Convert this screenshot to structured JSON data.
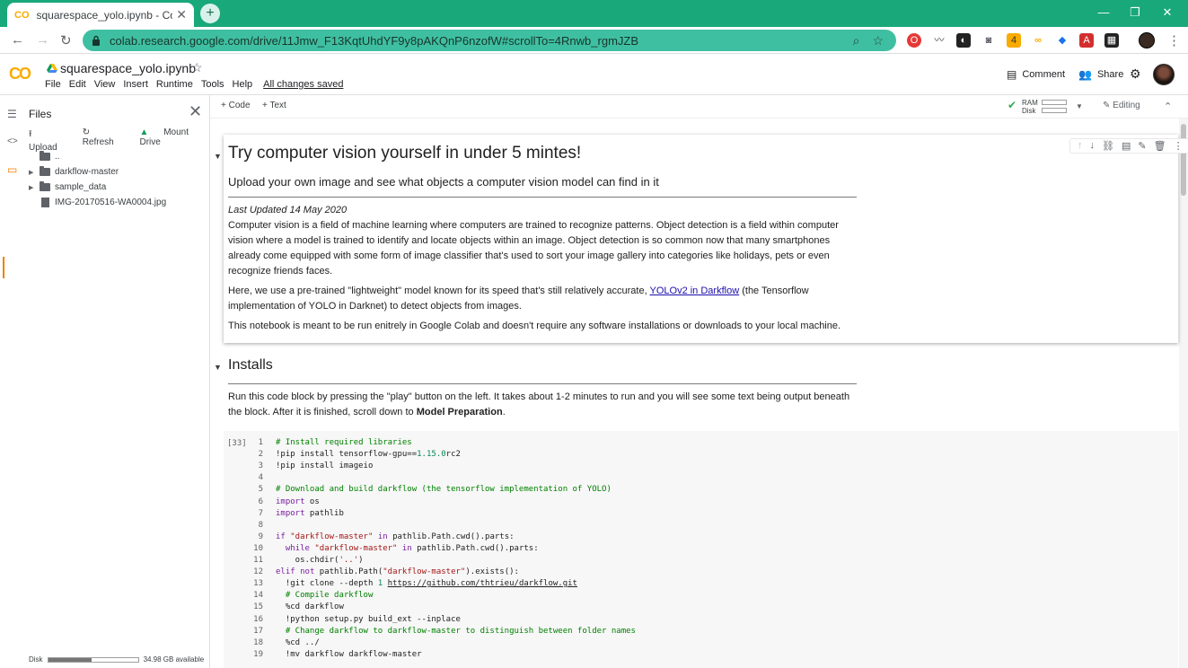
{
  "browser": {
    "tab_title": "squarespace_yolo.ipynb - Colabo",
    "tab_logo": "CO",
    "url": "colab.research.google.com/drive/11Jmw_F13KqtUhdYF9y8pAKQnP6nzofW#scrollTo=4Rnwb_rgmJZB",
    "extension_badge": "4"
  },
  "colab": {
    "logo": "CO",
    "doc_name": "squarespace_yolo.ipynb",
    "menus": [
      "File",
      "Edit",
      "View",
      "Insert",
      "Runtime",
      "Tools",
      "Help"
    ],
    "save_status": "All changes saved",
    "comment_label": "Comment",
    "share_label": "Share"
  },
  "files_panel": {
    "title": "Files",
    "upload_label": "Upload",
    "refresh_label": "Refresh",
    "mount_label": "Mount Drive",
    "items": [
      {
        "name": "..",
        "type": "folder"
      },
      {
        "name": "darkflow-master",
        "type": "folder"
      },
      {
        "name": "sample_data",
        "type": "folder"
      },
      {
        "name": "IMG-20170516-WA0004.jpg",
        "type": "file"
      }
    ],
    "disk_label": "Disk",
    "disk_available": "34.98 GB available",
    "disk_used_fraction": 0.48
  },
  "toolbar": {
    "code_label": "Code",
    "text_label": "Text",
    "ram_label": "RAM",
    "disk_label": "Disk",
    "editing_label": "Editing"
  },
  "notebook": {
    "intro": {
      "title": "Try computer vision yourself in under 5 mintes!",
      "subtitle": "Upload your own image and see what objects a computer vision model can find in it",
      "updated": "Last Updated 14 May 2020",
      "p1_a": "Computer vision is a field of machine learning where computers are trained to recognize patterns. Object detection is a field within computer",
      "p1_b": "vision where a model is trained to identify and locate objects within an image. Object detection is so common now that many smartphones",
      "p1_c": "already come equipped with some form of image classifier that's used to sort your image gallery into categories like holidays, pets or even",
      "p1_d": "recognize friends faces.",
      "p2_a": "Here, we use a pre-trained \"lightweight\" model known for its speed that's still relatively accurate,",
      "p2_link": "YOLOv2 in Darkflow",
      "p2_b": "(the Tensorflow",
      "p2_c": "implementation of YOLO in Darknet) to detect objects from images.",
      "p3": "This notebook is meant to be run enitrely in Google Colab and doesn't require any software installations or downloads to your local machine."
    },
    "installs": {
      "heading": "Installs",
      "p1": "Run this code block by pressing the \"play\" button on the left. It takes about 1-2 minutes to run and you will see some text being output beneath",
      "p2_a": "the block. After it is finished, scroll down to",
      "p2_bold": "Model Preparation",
      "p2_b": "."
    },
    "code_cell": {
      "exec_count": "[33]",
      "lines": [
        {
          "n": "1",
          "t": "# Install required libraries"
        },
        {
          "n": "2",
          "t": "!pip install tensorflow-gpu==1.15.0rc2"
        },
        {
          "n": "3",
          "t": "!pip install imageio"
        },
        {
          "n": "4",
          "t": ""
        },
        {
          "n": "5",
          "t": "# Download and build darkflow (the tensorflow implementation of YOLO)"
        },
        {
          "n": "6",
          "t": "import os"
        },
        {
          "n": "7",
          "t": "import pathlib"
        },
        {
          "n": "8",
          "t": ""
        },
        {
          "n": "9",
          "t": "if \"darkflow-master\" in pathlib.Path.cwd().parts:"
        },
        {
          "n": "10",
          "t": "  while \"darkflow-master\" in pathlib.Path.cwd().parts:"
        },
        {
          "n": "11",
          "t": "    os.chdir('..')"
        },
        {
          "n": "12",
          "t": "elif not pathlib.Path(\"darkflow-master\").exists():"
        },
        {
          "n": "13",
          "t": "  !git clone --depth 1 https://github.com/thtrieu/darkflow.git"
        },
        {
          "n": "14",
          "t": "  # Compile darkflow"
        },
        {
          "n": "15",
          "t": "  %cd darkflow"
        },
        {
          "n": "16",
          "t": "  !python setup.py build_ext --inplace"
        },
        {
          "n": "17",
          "t": "  # Change darkflow to darkflow-master to distinguish between folder names"
        },
        {
          "n": "18",
          "t": "  %cd ../"
        },
        {
          "n": "19",
          "t": "  !mv darkflow darkflow-master"
        }
      ]
    }
  },
  "colors": {
    "tab_strip": "#19a87a",
    "omnibox": "#3fbfa1",
    "colab_orange": "#f9ab00"
  }
}
